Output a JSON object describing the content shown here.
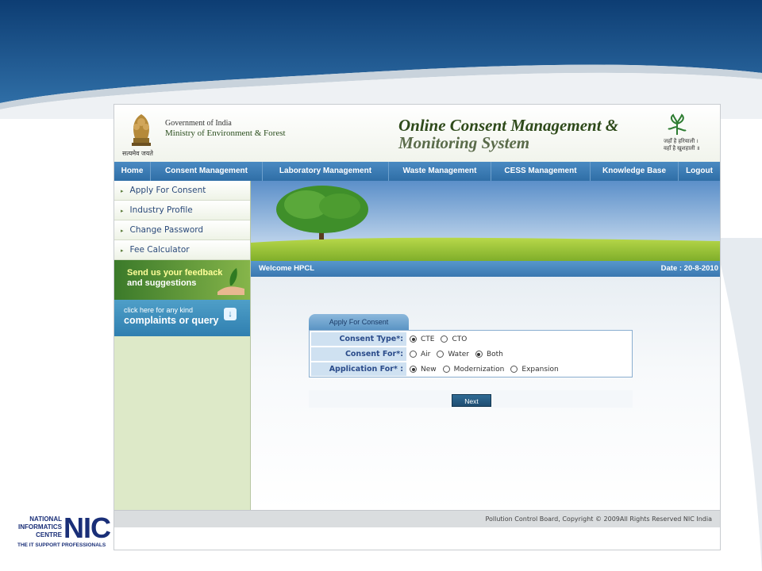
{
  "header": {
    "gov_line1": "Government of India",
    "gov_line2": "Ministry of Environment & Forest",
    "motto": "सत्यमेव जयते",
    "title_line1": "Online Consent Management &",
    "title_line2": "Monitoring System",
    "green_tag_line1": "जहाँ है हरियाली ।",
    "green_tag_line2": "वहाँ है खुशहाली ॥"
  },
  "nav": {
    "items": [
      {
        "label": "Home"
      },
      {
        "label": "Consent Management"
      },
      {
        "label": "Laboratory Management"
      },
      {
        "label": "Waste Management"
      },
      {
        "label": "CESS Management"
      },
      {
        "label": "Knowledge Base"
      },
      {
        "label": "Logout"
      }
    ]
  },
  "sidebar": {
    "items": [
      {
        "label": "Apply For Consent"
      },
      {
        "label": "Industry Profile"
      },
      {
        "label": "Change Password"
      },
      {
        "label": "Fee Calculator"
      }
    ],
    "feedback_line1": "Send us your feedback",
    "feedback_line2": "and suggestions",
    "complaint_line1": "click here for any kind",
    "complaint_line2": "complaints or query"
  },
  "welcome": {
    "text": "Welcome HPCL",
    "date": "Date : 20-8-2010"
  },
  "form": {
    "tab_label": "Apply For Consent",
    "rows": [
      {
        "label": "Consent Type*:",
        "options": [
          {
            "label": "CTE",
            "checked": true
          },
          {
            "label": "CTO",
            "checked": false
          }
        ]
      },
      {
        "label": "Consent For*:",
        "options": [
          {
            "label": "Air",
            "checked": false
          },
          {
            "label": "Water",
            "checked": false
          },
          {
            "label": "Both",
            "checked": true
          }
        ]
      },
      {
        "label": "Application For* :",
        "options": [
          {
            "label": "New",
            "checked": true
          },
          {
            "label": "Modernization",
            "checked": false
          },
          {
            "label": "Expansion",
            "checked": false
          }
        ]
      }
    ],
    "next_label": "Next"
  },
  "footer": {
    "text": "Pollution Control Board, Copyright © 2009All Rights Reserved NIC India"
  },
  "nic_logo": {
    "line1": "NATIONAL",
    "line2": "INFORMATICS",
    "line3": "CENTRE",
    "big": "NIC",
    "tagline": "THE IT SUPPORT PROFESSIONALS"
  },
  "colors": {
    "nav_blue": "#3a78b0",
    "sidebar_green": "#dde9c8",
    "title_green": "#2e4a1a"
  }
}
